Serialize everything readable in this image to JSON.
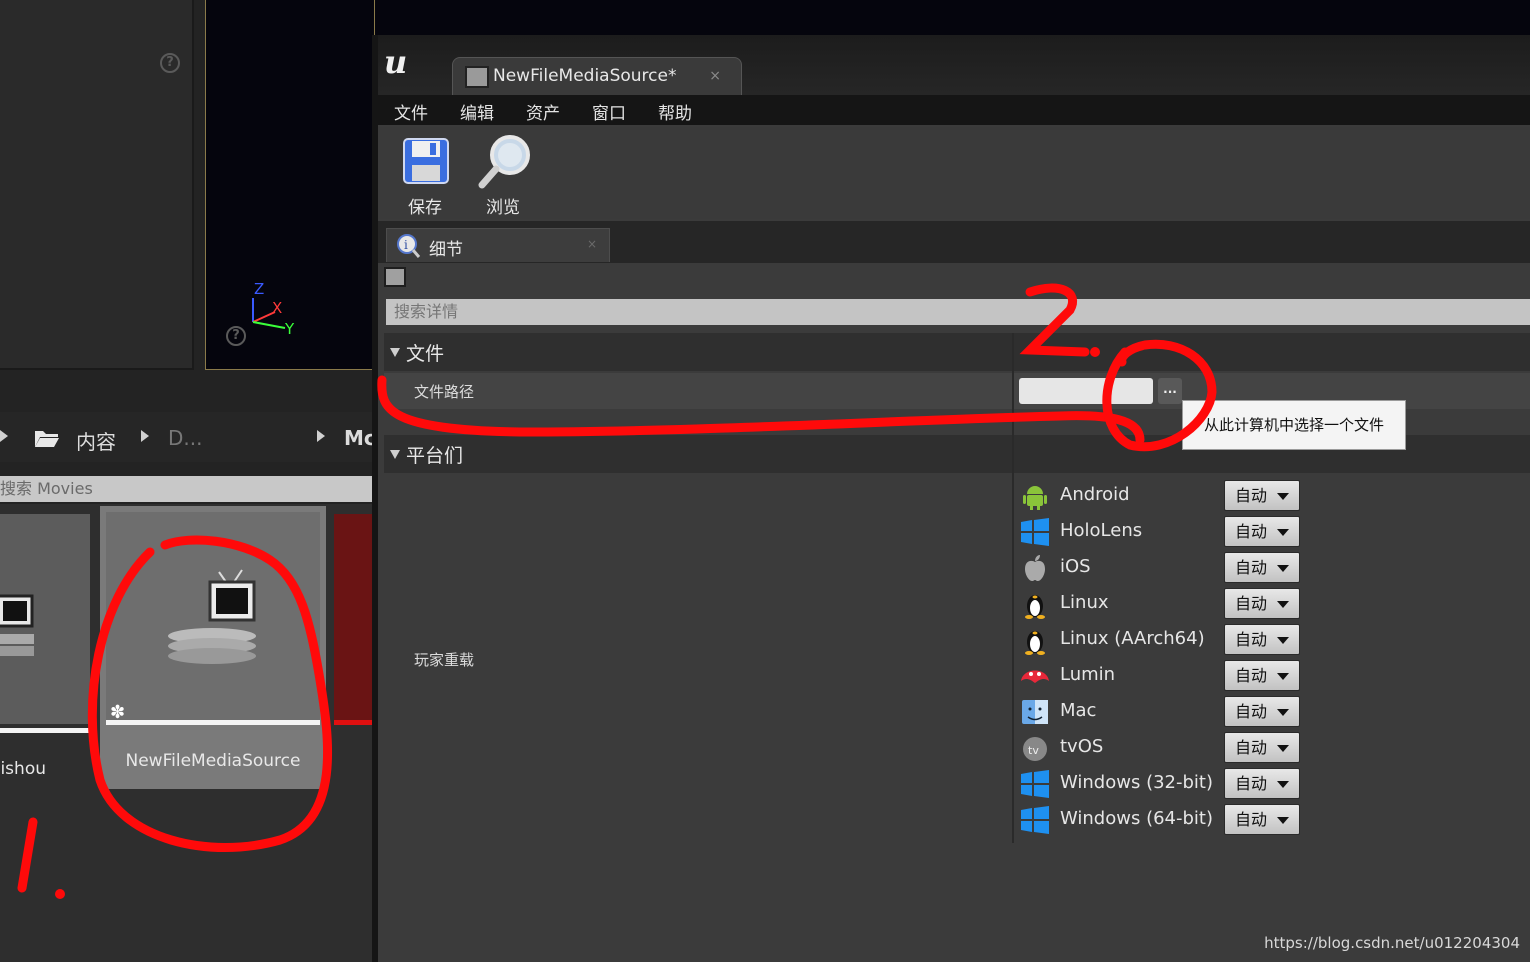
{
  "editor_tab": {
    "title": "NewFileMediaSource*",
    "close": "×"
  },
  "menu": [
    "文件",
    "编辑",
    "资产",
    "窗口",
    "帮助"
  ],
  "toolbar": {
    "save_label": "保存",
    "browse_label": "浏览"
  },
  "details": {
    "tab_title": "细节",
    "tab_close": "×",
    "search_placeholder": "搜索详情",
    "category_file": "文件",
    "file_path_label": "文件路径",
    "browse_button": "...",
    "tooltip": "从此计算机中选择一个文件",
    "category_platforms": "平台们",
    "player_overrides_label": "玩家重载",
    "platforms": [
      {
        "name": "Android",
        "value": "自动",
        "icon": "android-icon"
      },
      {
        "name": "HoloLens",
        "value": "自动",
        "icon": "windows-icon"
      },
      {
        "name": "iOS",
        "value": "自动",
        "icon": "apple-icon"
      },
      {
        "name": "Linux",
        "value": "自动",
        "icon": "linux-icon"
      },
      {
        "name": "Linux (AArch64)",
        "value": "自动",
        "icon": "linux-icon"
      },
      {
        "name": "Lumin",
        "value": "自动",
        "icon": "lumin-icon"
      },
      {
        "name": "Mac",
        "value": "自动",
        "icon": "mac-finder-icon"
      },
      {
        "name": "tvOS",
        "value": "自动",
        "icon": "apple-tv-icon"
      },
      {
        "name": "Windows (32-bit)",
        "value": "自动",
        "icon": "windows-icon"
      },
      {
        "name": "Windows (64-bit)",
        "value": "自动",
        "icon": "windows-icon"
      }
    ]
  },
  "content_browser": {
    "breadcrumb": [
      "内容",
      "D...",
      "Mc"
    ],
    "search_placeholder": "搜索 Movies",
    "assets": [
      "eishou",
      "NewFileMediaSource"
    ]
  },
  "viewport": {
    "axis_z": "Z",
    "axis_x": "X",
    "axis_y": "Y"
  },
  "annotations": {
    "mark_1": "1.",
    "mark_2": "2."
  },
  "watermark": "https://blog.csdn.net/u012204304",
  "colors": {
    "annotation_red": "#ff0a0a",
    "window_bg": "#3b3b3b",
    "dropdown_bg": "#d6d6d6"
  }
}
